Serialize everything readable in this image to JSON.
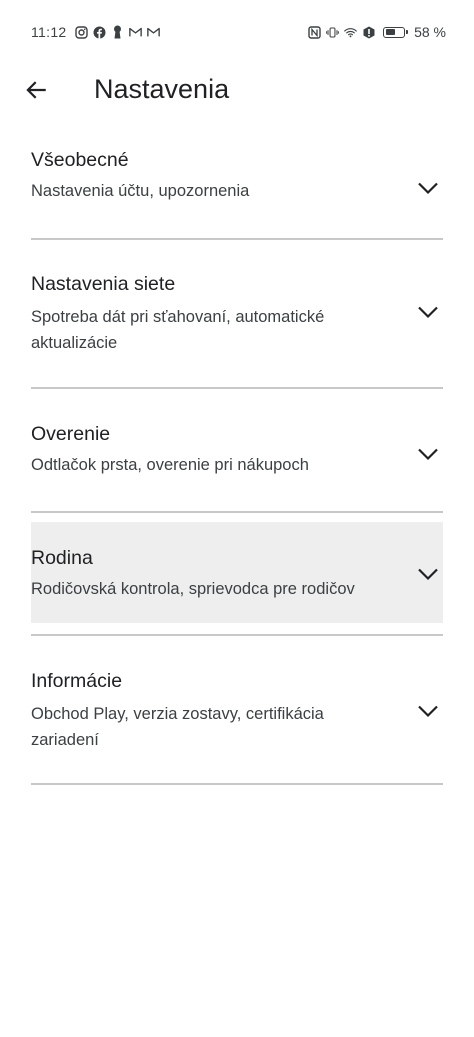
{
  "status_bar": {
    "time": "11:12",
    "battery_text": "58 %",
    "battery_level_percent": 58,
    "left_icons": [
      "instagram-icon",
      "facebook-icon",
      "keyhole-icon",
      "gmail-icon",
      "gmail-icon"
    ],
    "right_icons": [
      "nfc-icon",
      "vibrate-icon",
      "wifi-icon",
      "alert-icon",
      "battery-icon"
    ]
  },
  "app_bar": {
    "back_icon": "arrow-left-icon",
    "title": "Nastavenia"
  },
  "settings": [
    {
      "id": "vseobecne",
      "title": "Všeobecné",
      "subtitle_lines": [
        "Nastavenia účtu, upozornenia"
      ],
      "highlighted": false,
      "icon": "chevron-down-icon"
    },
    {
      "id": "nastavenia-siete",
      "title": "Nastavenia siete",
      "subtitle_lines": [
        "Spotreba dát pri sťahovaní, automatické",
        "aktualizácie"
      ],
      "highlighted": false,
      "icon": "chevron-down-icon"
    },
    {
      "id": "overenie",
      "title": "Overenie",
      "subtitle_lines": [
        "Odtlačok prsta, overenie pri nákupoch"
      ],
      "highlighted": false,
      "icon": "chevron-down-icon"
    },
    {
      "id": "rodina",
      "title": "Rodina",
      "subtitle_lines": [
        "Rodičovská kontrola, sprievodca pre rodičov"
      ],
      "highlighted": true,
      "icon": "chevron-down-icon"
    },
    {
      "id": "informacie",
      "title": "Informácie",
      "subtitle_lines": [
        "Obchod Play, verzia zostavy, certifikácia",
        "zariadení"
      ],
      "highlighted": false,
      "icon": "chevron-down-icon"
    }
  ],
  "colors": {
    "background": "#ffffff",
    "text_primary": "#202124",
    "text_secondary": "#3c4043",
    "divider": "#c8c8c8",
    "highlight": "#eeeeee"
  }
}
